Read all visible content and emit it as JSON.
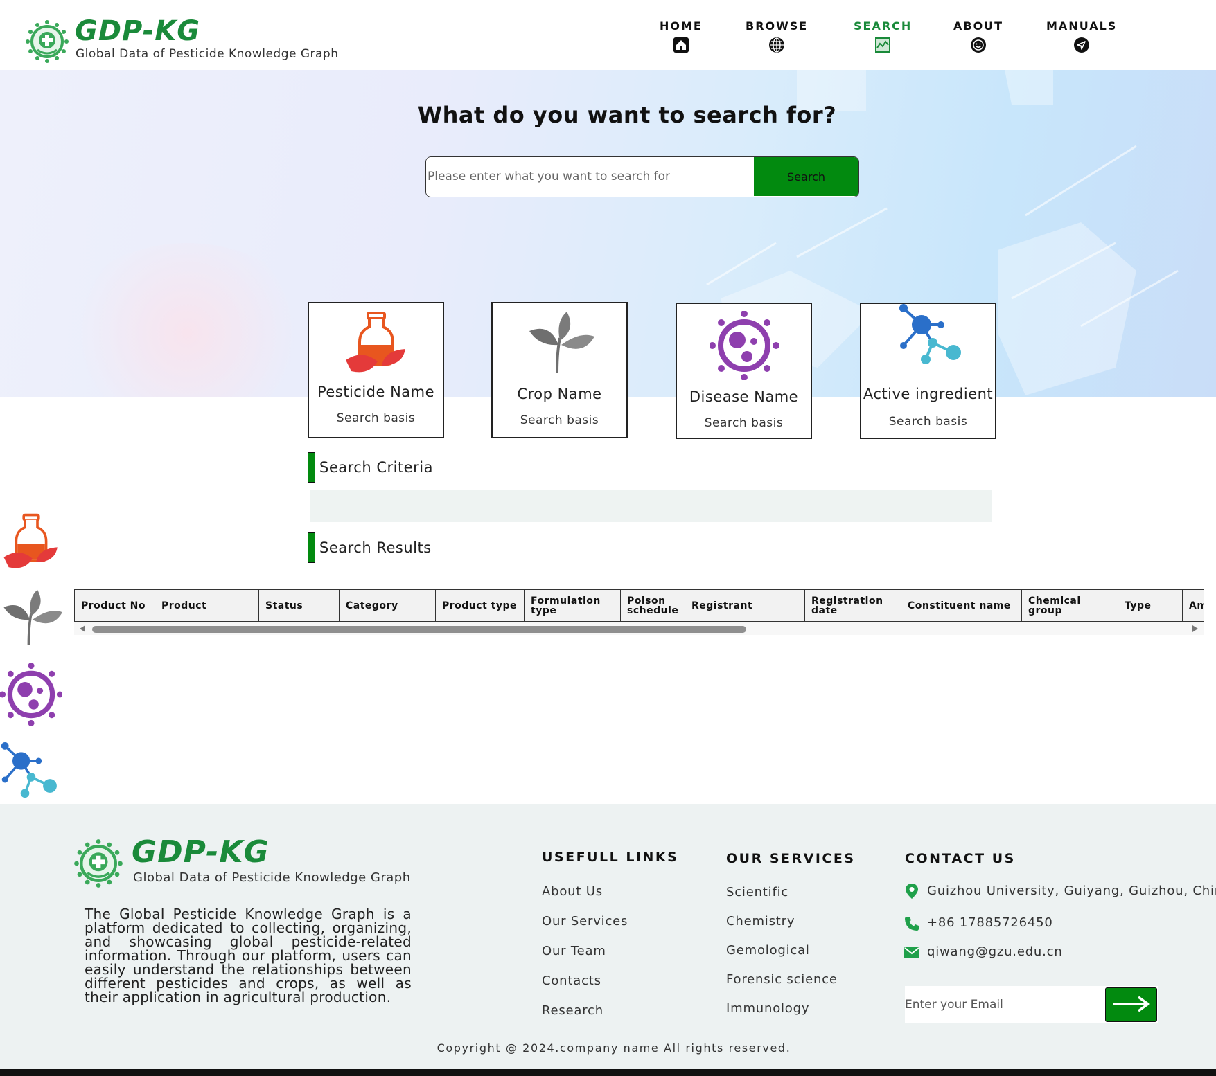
{
  "header": {
    "brand": "GDP-KG",
    "subtitle": "Global Data of Pesticide Knowledge Graph",
    "nav": [
      {
        "label": "HOME",
        "icon": "home-icon"
      },
      {
        "label": "BROWSE",
        "icon": "globe-icon"
      },
      {
        "label": "SEARCH",
        "icon": "chart-icon",
        "active": true
      },
      {
        "label": "ABOUT",
        "icon": "smile-icon"
      },
      {
        "label": "MANUALS",
        "icon": "send-icon"
      }
    ]
  },
  "hero": {
    "title": "What do you want to search for?",
    "search_placeholder": "Please enter what you want to search for",
    "search_button": "Search"
  },
  "cards": [
    {
      "title": "Pesticide Name",
      "sub": "Search basis",
      "icon": "pesticide-bottle-icon"
    },
    {
      "title": "Crop Name",
      "sub": "Search basis",
      "icon": "leaf-icon"
    },
    {
      "title": "Disease Name",
      "sub": "Search basis",
      "icon": "virus-icon"
    },
    {
      "title": "Active ingredient",
      "sub": "Search basis",
      "icon": "molecule-icon"
    }
  ],
  "sections": {
    "criteria": "Search Criteria",
    "results": "Search Results"
  },
  "table": {
    "columns": [
      "Product No",
      "Product",
      "Status",
      "Category",
      "Product type",
      "Formulation type",
      "Poison schedule",
      "Registrant",
      "Registration date",
      "Constituent name",
      "Chemical group",
      "Type",
      "Am"
    ]
  },
  "footer": {
    "brand": "GDP-KG",
    "subtitle": "Global Data of Pesticide Knowledge Graph",
    "about": "The Global Pesticide Knowledge Graph is a platform dedicated to collecting, organizing, and showcasing global pesticide-related information. Through our platform, users can easily understand the relationships between different pesticides and crops, as well as their application in agricultural production.",
    "useful_links_title": "USEFULL LINKS",
    "useful_links": [
      "About Us",
      "Our Services",
      "Our Team",
      "Contacts",
      "Research"
    ],
    "services_title": "OUR SERVICES",
    "services": [
      "Scientific",
      "Chemistry",
      "Gemological",
      "Forensic science",
      "Immunology"
    ],
    "contact_title": "CONTACT US",
    "address": "Guizhou University, Guiyang, Guizhou, China",
    "phone": "+86 17885726450",
    "email": "qiwang@gzu.edu.cn",
    "email_placeholder": "Enter your Email",
    "copyright": "Copyright @ 2024.company name All rights reserved."
  },
  "colors": {
    "brand_green": "#1a8a3a",
    "button_green": "#028a0f",
    "footer_bg": "#edf2f2"
  }
}
